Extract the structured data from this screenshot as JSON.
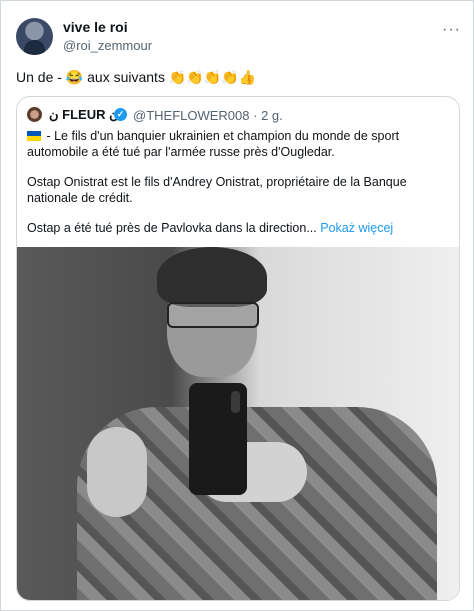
{
  "author": {
    "name": "vive le roi",
    "handle": "@roi_zemmour"
  },
  "post_text": "Un de - 😂 aux suivants 👏👏👏👏👍",
  "menu_icon": "more-dots-icon",
  "quoted": {
    "name": "ن FLEUR ن",
    "handle": "@THEFLOWER008",
    "time": "· 2 g.",
    "paragraph1": " - Le fils d'un banquier ukrainien et champion du monde de sport automobile  a été tué par l'armée russe près d'Ougledar.",
    "paragraph2": "Ostap Onistrat est le fils d'Andrey Onistrat, propriétaire de la Banque nationale de crédit.",
    "paragraph3": "Ostap a été tué près de Pavlovka dans la direction...",
    "show_more": "Pokaż więcej",
    "flag": "ukraine-flag-icon",
    "verified_icon": "verified-badge-icon"
  },
  "colors": {
    "link": "#1d9bf0",
    "secondary": "#536471",
    "border": "#cfd9de"
  }
}
